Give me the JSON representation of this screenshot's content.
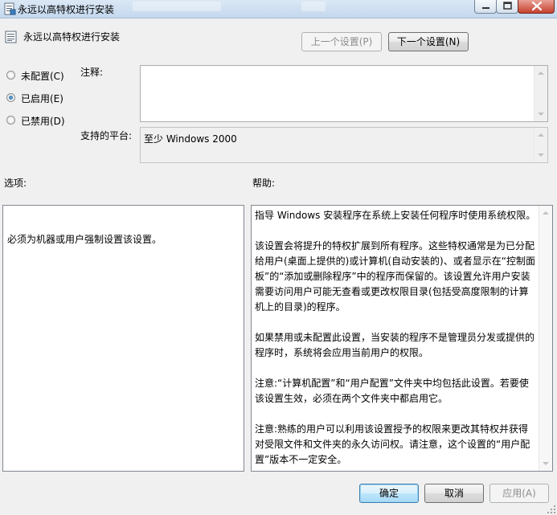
{
  "window": {
    "title": "永远以高特权进行安装"
  },
  "header": {
    "title": "永远以高特权进行安装",
    "prev_label": "上一个设置(P)",
    "next_label": "下一个设置(N)"
  },
  "state": {
    "not_configured": "未配置(C)",
    "enabled": "已启用(E)",
    "disabled": "已禁用(D)",
    "selected": "enabled"
  },
  "comment": {
    "label": "注释:",
    "value": ""
  },
  "platform": {
    "label": "支持的平台:",
    "value": "至少 Windows 2000"
  },
  "options": {
    "label": "选项:",
    "text": "必须为机器或用户强制设置该设置。"
  },
  "help": {
    "label": "帮助:",
    "paragraphs": [
      "指导 Windows 安装程序在系统上安装任何程序时使用系统权限。",
      "该设置会将提升的特权扩展到所有程序。这些特权通常是为已分配给用户(桌面上提供的)或计算机(自动安装的)、或者显示在“控制面板”的“添加或删除程序”中的程序而保留的。该设置允许用户安装需要访问用户可能无查看或更改权限目录(包括受高度限制的计算机上的目录)的程序。",
      "如果禁用或未配置此设置，当安装的程序不是管理员分发或提供的程序时，系统将会应用当前用户的权限。",
      "注意:“计算机配置”和“用户配置”文件夹中均包括此设置。若要使该设置生效，必须在两个文件夹中都启用它。",
      "注意:熟练的用户可以利用该设置授予的权限来更改其特权并获得对受限文件和文件夹的永久访问权。请注意，这个设置的“用户配置”版本不一定安全。"
    ]
  },
  "footer": {
    "ok": "确定",
    "cancel": "取消",
    "apply": "应用(A)"
  },
  "icons": {
    "app": "policy-icon",
    "header": "policy-setting-icon"
  }
}
